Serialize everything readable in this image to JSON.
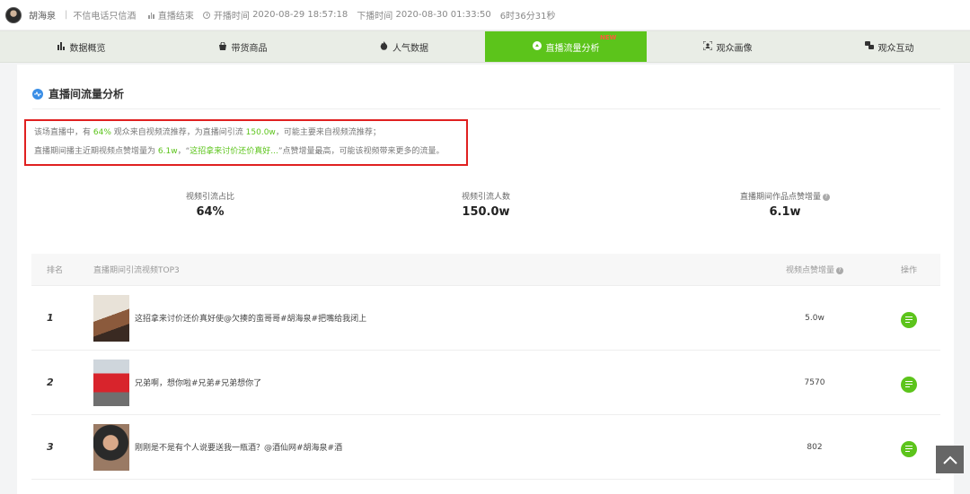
{
  "header": {
    "anchor_name": "胡海泉",
    "slogan": "不信电话只信酒",
    "status": "直播结束",
    "start_label": "开播时间",
    "start_time": "2020-08-29 18:57:18",
    "end_label": "下播时间",
    "end_time": "2020-08-30 01:33:50",
    "duration": "6时36分31秒"
  },
  "tabs": [
    {
      "label": "数据概览",
      "icon": "bar-chart-icon"
    },
    {
      "label": "带货商品",
      "icon": "shopping-bag-icon"
    },
    {
      "label": "人气数据",
      "icon": "flame-icon"
    },
    {
      "label": "直播流量分析",
      "icon": "traffic-icon",
      "active": true,
      "badge": "NEW"
    },
    {
      "label": "观众画像",
      "icon": "portrait-icon"
    },
    {
      "label": "观众互动",
      "icon": "chat-icon"
    }
  ],
  "section": {
    "title": "直播间流量分析"
  },
  "summary": {
    "line1_a": "该场直播中，有",
    "line1_pct": "64%",
    "line1_b": "观众来自视频流推荐，为直播间引流",
    "line1_num": "150.0w",
    "line1_c": "，可能主要来自视频流推荐；",
    "line2_a": "直播期间播主近期视频点赞增量为",
    "line2_num": "6.1w",
    "line2_b": "，“",
    "line2_video": "这招拿来讨价还价真好...",
    "line2_c": "”点赞增量最高，可能该视频带来更多的流量。"
  },
  "stats": [
    {
      "label": "视频引流占比",
      "value": "64%"
    },
    {
      "label": "视频引流人数",
      "value": "150.0w"
    },
    {
      "label": "直播期间作品点赞增量",
      "value": "6.1w"
    }
  ],
  "table": {
    "headers": {
      "rank": "排名",
      "video": "直播期间引流视频TOP3",
      "likes": "视频点赞增量",
      "op": "操作"
    },
    "rows": [
      {
        "rank": "1",
        "title": "这招拿来讨价还价真好使@欠揍的蛮哥哥#胡海泉#把嘴给我闭上",
        "likes": "5.0w"
      },
      {
        "rank": "2",
        "title": "兄弟啊，想你啦#兄弟#兄弟想你了",
        "likes": "7570"
      },
      {
        "rank": "3",
        "title": "刚刚是不是有个人说要送我一瓶酒？@酒仙网#胡海泉#酒",
        "likes": "802"
      }
    ]
  },
  "colors": {
    "accent": "#5cc41b",
    "highlight_border": "#e02020",
    "info": "#3a8ee6"
  }
}
